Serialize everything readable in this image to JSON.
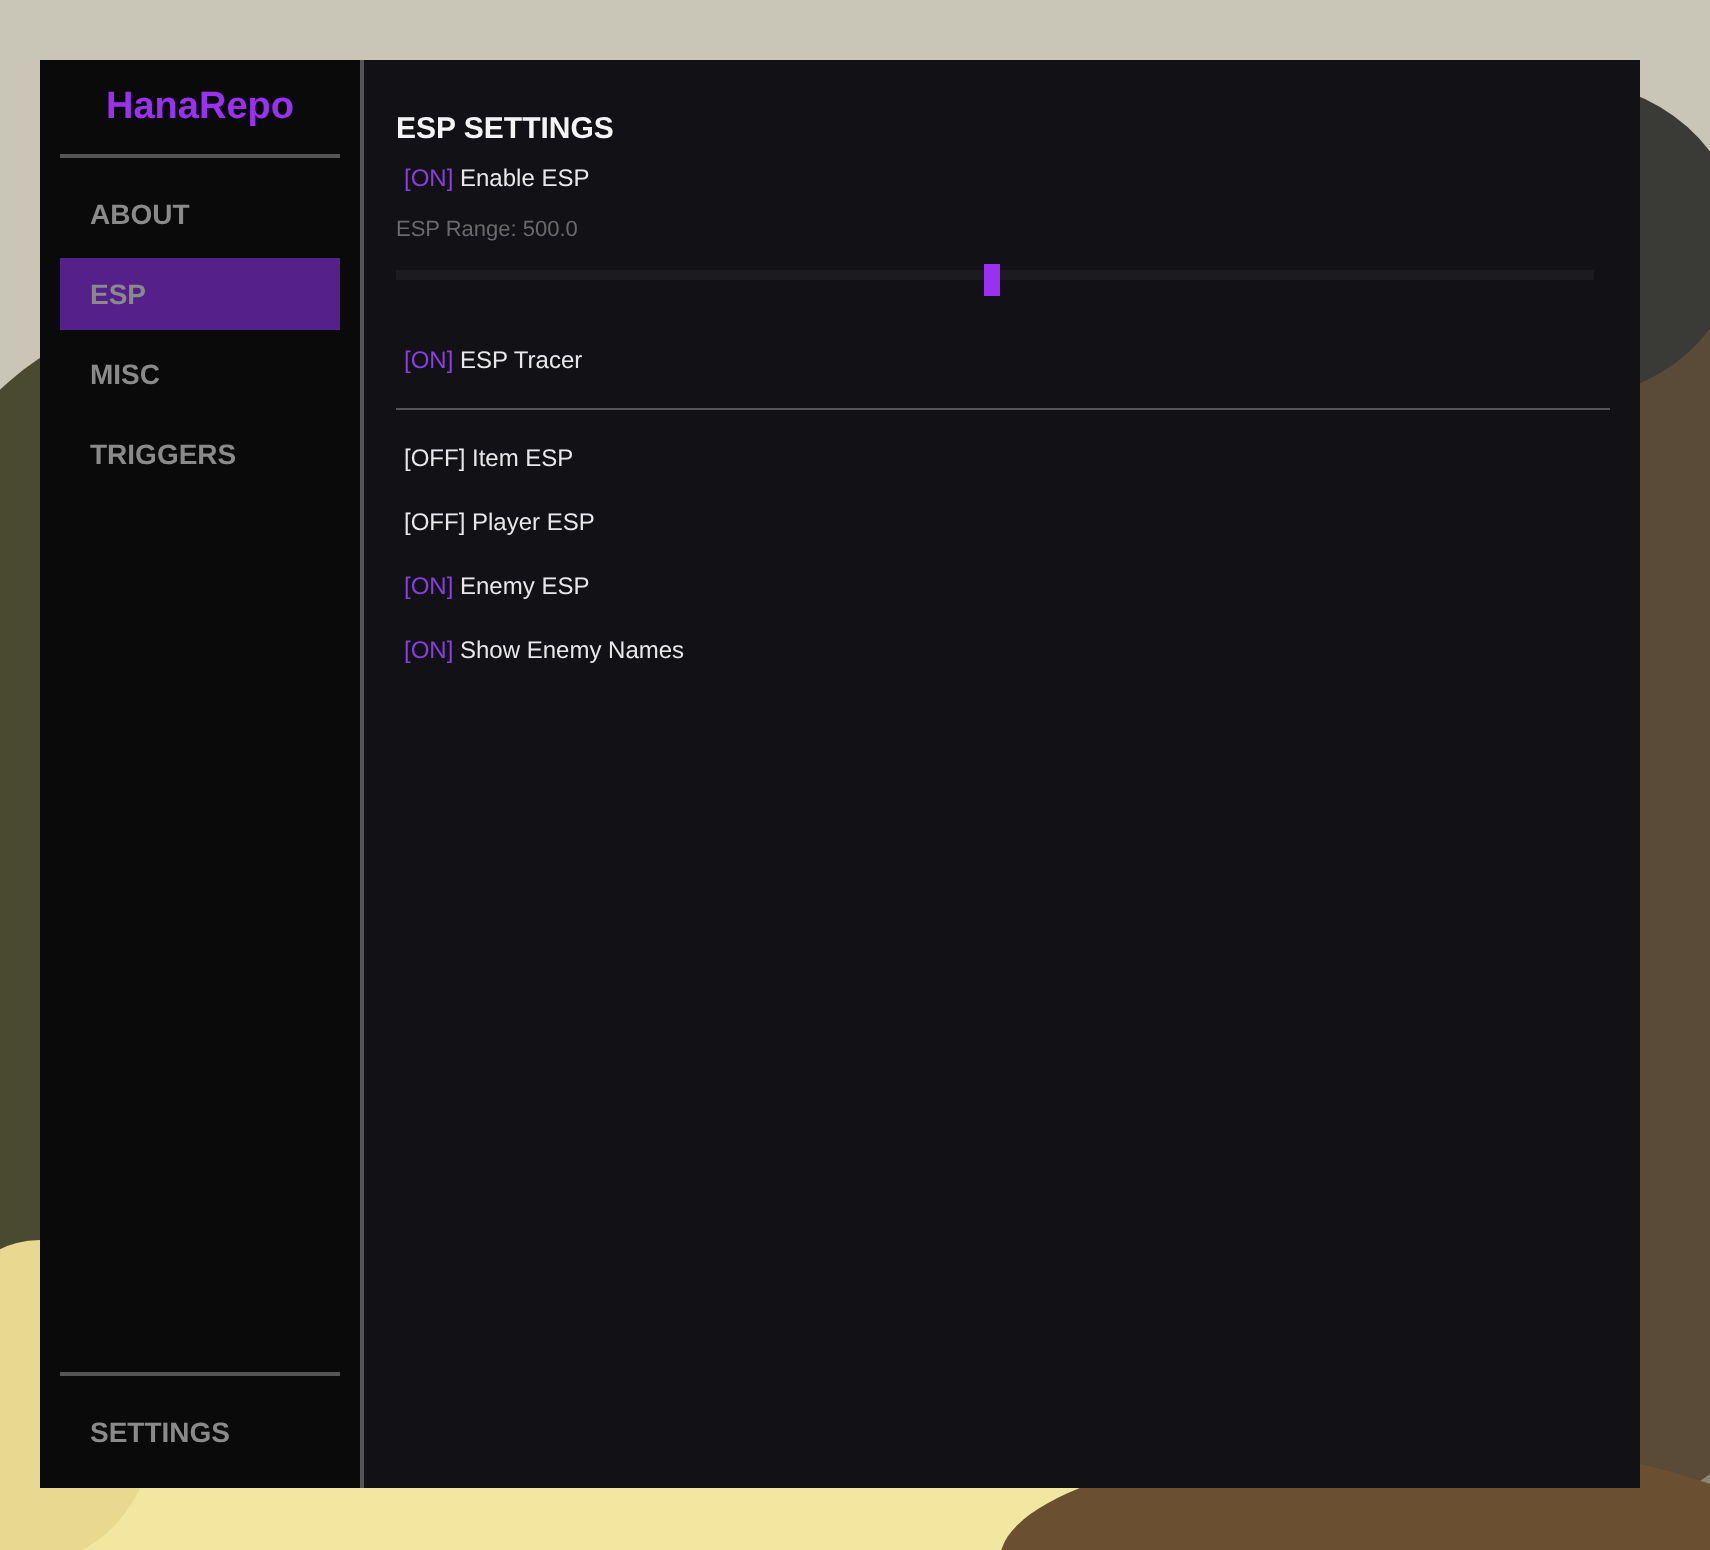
{
  "sidebar": {
    "logo": "HanaRepo",
    "items": [
      {
        "label": "ABOUT",
        "selected": false
      },
      {
        "label": "ESP",
        "selected": true
      },
      {
        "label": "MISC",
        "selected": false
      },
      {
        "label": "TRIGGERS",
        "selected": false
      }
    ],
    "footer_item": {
      "label": "SETTINGS",
      "selected": false
    }
  },
  "content": {
    "title": "ESP SETTINGS",
    "groups": [
      [
        {
          "kind": "toggle",
          "state": "[ON]",
          "on": true,
          "label": "Enable ESP"
        },
        {
          "kind": "slider",
          "label": "ESP Range: 500.0",
          "level": 0.497
        },
        {
          "kind": "toggle",
          "state": "[ON]",
          "on": true,
          "label": "ESP Tracer"
        }
      ],
      [
        {
          "kind": "toggle",
          "state": "[OFF]",
          "on": false,
          "label": "Item ESP"
        },
        {
          "kind": "toggle",
          "state": "[OFF]",
          "on": false,
          "label": "Player ESP"
        },
        {
          "kind": "toggle",
          "state": "[ON]",
          "on": true,
          "label": "Enemy ESP"
        },
        {
          "kind": "toggle",
          "state": "[ON]",
          "on": true,
          "label": "Show Enemy Names"
        }
      ]
    ]
  }
}
